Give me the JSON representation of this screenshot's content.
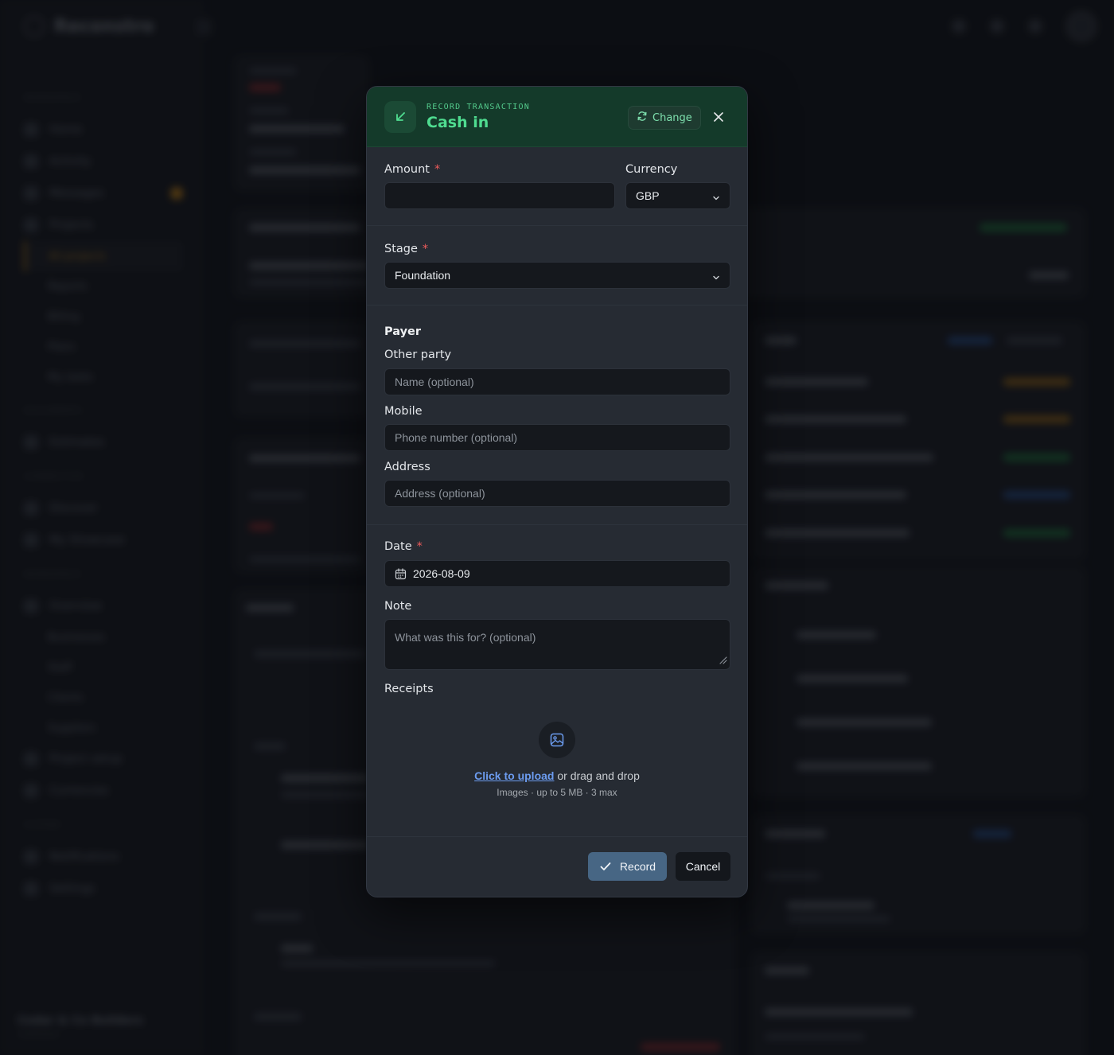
{
  "app": {
    "name": "Reconstro",
    "nav": [
      {
        "section": "WORKSPACE"
      },
      {
        "label": "Home"
      },
      {
        "label": "Activity"
      },
      {
        "label": "Messages",
        "badge": true
      },
      {
        "label": "Projects"
      },
      {
        "label": "All projects",
        "sub": true,
        "active": true
      },
      {
        "label": "Reports",
        "sub": true
      },
      {
        "label": "Billing",
        "sub": true
      },
      {
        "label": "Plans",
        "sub": true
      },
      {
        "label": "My tasks",
        "sub": true
      },
      {
        "section": "DOCUMENTS"
      },
      {
        "label": "Estimates"
      },
      {
        "section": "CONNECTIVE"
      },
      {
        "label": "Discover"
      },
      {
        "label": "My Showcase"
      },
      {
        "section": "WORKSPACE"
      },
      {
        "label": "Overview"
      },
      {
        "label": "Businesses",
        "sub": true
      },
      {
        "label": "Staff",
        "sub": true
      },
      {
        "label": "Clients",
        "sub": true
      },
      {
        "label": "Suppliers",
        "sub": true
      },
      {
        "label": "Project setup"
      },
      {
        "label": "Currencies"
      },
      {
        "section": "SYSTEM"
      },
      {
        "label": "Notifications"
      },
      {
        "label": "Settings"
      }
    ],
    "org_name": "Cedar & Co Builders",
    "org_role": "Contractor"
  },
  "modal": {
    "eyebrow": "RECORD TRANSACTION",
    "title": "Cash in",
    "change_label": "Change",
    "amount": {
      "label": "Amount",
      "required": "*",
      "value": ""
    },
    "currency": {
      "label": "Currency",
      "value": "GBP"
    },
    "stage": {
      "label": "Stage",
      "required": "*",
      "value": "Foundation"
    },
    "payer": {
      "title": "Payer",
      "other_party_label": "Other party",
      "name_placeholder": "Name (optional)",
      "mobile_label": "Mobile",
      "mobile_placeholder": "Phone number (optional)",
      "address_label": "Address",
      "address_placeholder": "Address (optional)"
    },
    "date": {
      "label": "Date",
      "required": "*",
      "value": "2026-08-09"
    },
    "note": {
      "label": "Note",
      "placeholder": "What was this for? (optional)"
    },
    "receipts": {
      "label": "Receipts",
      "upload_link": "Click to upload",
      "upload_rest": " or drag and drop",
      "hint": "Images · up to 5 MB · 3 max"
    },
    "record_label": "Record",
    "cancel_label": "Cancel"
  },
  "colors": {
    "header_bg": "#143a2a",
    "accent_green": "#4fdc90",
    "record_btn": "#476684",
    "required": "#ef5b5b",
    "link": "#6c9cf0"
  }
}
